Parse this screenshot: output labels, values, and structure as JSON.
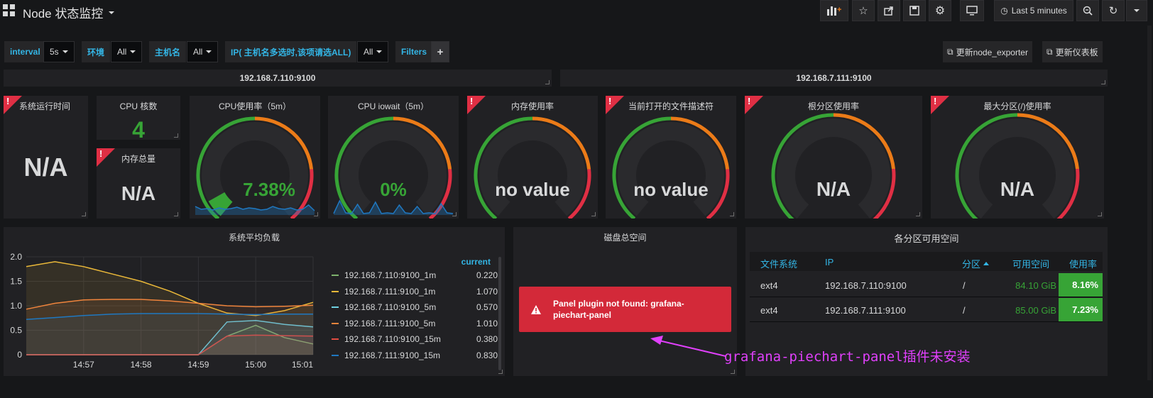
{
  "topbar": {
    "title": "Node 状态监控",
    "time_range": "Last 5 minutes"
  },
  "variables": [
    {
      "label": "interval",
      "value": "5s"
    },
    {
      "label": "环境",
      "value": "All"
    },
    {
      "label": "主机名",
      "value": "All"
    },
    {
      "label": "IP( 主机名多选时,该项请选ALL)",
      "value": "All"
    },
    {
      "label": "Filters",
      "value": "+"
    }
  ],
  "links": {
    "update_exporter": "更新node_exporter",
    "update_dashboard": "更新仪表板"
  },
  "rows": {
    "left": "192.168.7.110:9100",
    "right": "192.168.7.111:9100"
  },
  "panels": {
    "uptime": {
      "title": "系统运行时间",
      "value": "N/A"
    },
    "cpu_cores": {
      "title": "CPU 核数",
      "value": "4"
    },
    "mem_total": {
      "title": "内存总量",
      "value": "N/A"
    },
    "cpu_usage": {
      "title": "CPU使用率（5m）",
      "value": "7.38%",
      "fraction": 0.0738
    },
    "cpu_iowait": {
      "title": "CPU iowait（5m）",
      "value": "0%",
      "fraction": 0.0
    },
    "mem_usage": {
      "title": "内存使用率",
      "value": "no value"
    },
    "open_fds": {
      "title": "当前打开的文件描述符",
      "value": "no value"
    },
    "root_usage": {
      "title": "根分区使用率",
      "value": "N/A"
    },
    "max_partition": {
      "title": "最大分区(/)使用率",
      "value": "N/A"
    },
    "load": {
      "title": "系统平均负载",
      "legend_header": "current"
    },
    "disk_total": {
      "title": "磁盘总空间",
      "error": "Panel plugin not found: grafana-piechart-panel"
    },
    "partitions": {
      "title": "各分区可用空间",
      "columns": [
        "文件系统",
        "IP",
        "分区",
        "可用空间",
        "使用率"
      ],
      "rows": [
        {
          "fs": "ext4",
          "ip": "192.168.7.110:9100",
          "part": "/",
          "avail": "84.10 GiB",
          "usage": "8.16%"
        },
        {
          "fs": "ext4",
          "ip": "192.168.7.111:9100",
          "part": "/",
          "avail": "85.00 GiB",
          "usage": "7.23%"
        }
      ]
    }
  },
  "annotation": "grafana-piechart-panel插件未安装",
  "colors": {
    "green": "#37a436",
    "orange": "#eb7b18",
    "red": "#e02f44",
    "blue": "#33b5e5"
  },
  "icons": [
    "grid-icon",
    "add-panel-icon",
    "star-icon",
    "share-icon",
    "save-icon",
    "gear-icon",
    "tv-icon",
    "clock-icon",
    "zoom-out-icon",
    "refresh-icon",
    "alert-icon",
    "link-icon"
  ],
  "chart_data": {
    "type": "line",
    "x": [
      "14:56:00",
      "14:56:30",
      "14:57:00",
      "14:57:30",
      "14:58:00",
      "14:58:30",
      "14:59:00",
      "14:59:30",
      "15:00:00",
      "15:00:30",
      "15:01:00"
    ],
    "xticks": [
      "14:57",
      "14:58",
      "14:59",
      "15:00",
      "15:01"
    ],
    "ylim": [
      0,
      2.0
    ],
    "yticks": [
      "2.0",
      "1.5",
      "1.0",
      "0.5",
      "0"
    ],
    "series": [
      {
        "name": "192.168.7.110:9100_1m",
        "color": "#7eb26d",
        "current": "0.220",
        "values": [
          0,
          0,
          0,
          0,
          0,
          0,
          0,
          0.38,
          0.6,
          0.35,
          0.22
        ]
      },
      {
        "name": "192.168.7.111:9100_1m",
        "color": "#eab839",
        "current": "1.070",
        "values": [
          1.8,
          1.9,
          1.8,
          1.65,
          1.5,
          1.3,
          1.05,
          0.85,
          0.8,
          0.9,
          1.07
        ]
      },
      {
        "name": "192.168.7.110:9100_5m",
        "color": "#6ed0e0",
        "current": "0.570",
        "values": [
          0,
          0,
          0,
          0,
          0,
          0,
          0,
          0.67,
          0.7,
          0.62,
          0.57
        ]
      },
      {
        "name": "192.168.7.111:9100_5m",
        "color": "#ef843c",
        "current": "1.010",
        "values": [
          0.93,
          1.05,
          1.12,
          1.13,
          1.13,
          1.1,
          1.05,
          1.0,
          0.98,
          0.99,
          1.01
        ]
      },
      {
        "name": "192.168.7.110:9100_15m",
        "color": "#e24d42",
        "current": "0.380",
        "values": [
          0,
          0,
          0,
          0,
          0,
          0,
          0,
          0.38,
          0.4,
          0.39,
          0.38
        ]
      },
      {
        "name": "192.168.7.111:9100_15m",
        "color": "#1f78c1",
        "current": "0.830",
        "values": [
          0.72,
          0.76,
          0.8,
          0.83,
          0.84,
          0.84,
          0.84,
          0.83,
          0.82,
          0.83,
          0.83
        ]
      }
    ]
  }
}
